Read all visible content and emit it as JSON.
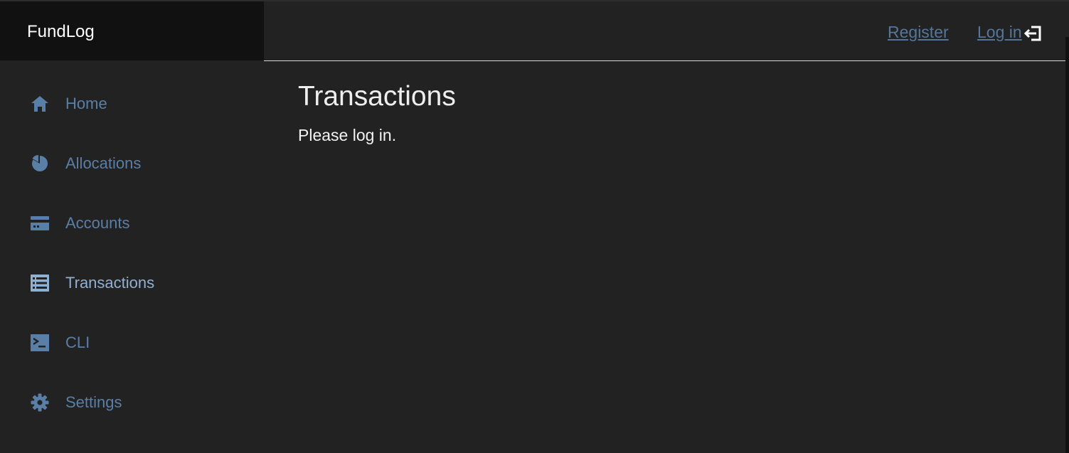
{
  "app": {
    "brand": "FundLog"
  },
  "header": {
    "register_label": "Register",
    "login_label": "Log in",
    "login_icon": "login-arrow-icon"
  },
  "sidebar": {
    "items": [
      {
        "label": "Home",
        "icon": "home-icon",
        "active": false
      },
      {
        "label": "Allocations",
        "icon": "pie-chart-icon",
        "active": false
      },
      {
        "label": "Accounts",
        "icon": "credit-card-icon",
        "active": false
      },
      {
        "label": "Transactions",
        "icon": "list-icon",
        "active": true
      },
      {
        "label": "CLI",
        "icon": "terminal-icon",
        "active": false
      },
      {
        "label": "Settings",
        "icon": "gear-icon",
        "active": false
      }
    ]
  },
  "main": {
    "title": "Transactions",
    "message": "Please log in."
  },
  "colors": {
    "background": "#222222",
    "brand_bar": "#111111",
    "link": "#54769a",
    "nav_text": "#5a7fa6",
    "active_nav_text": "#8fb0d3",
    "text": "#eeeeee"
  }
}
